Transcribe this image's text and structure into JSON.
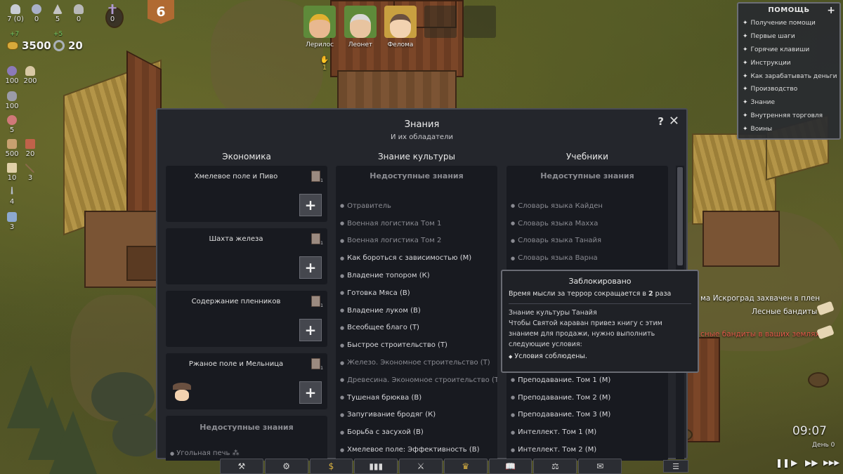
{
  "resources": {
    "top": [
      {
        "icon": "people-icon",
        "value": "7 (0)"
      },
      {
        "icon": "workers-icon",
        "value": "0"
      },
      {
        "icon": "soldiers-icon",
        "value": "5"
      },
      {
        "icon": "prisoners-icon",
        "value": "0"
      },
      {
        "icon": "dead-icon",
        "value": "0"
      }
    ],
    "gold_delta": "+7",
    "gold": "3500",
    "iron_delta": "+5",
    "iron": "20",
    "side": [
      {
        "a": "100",
        "b": "200"
      },
      {
        "a": "100",
        "b": ""
      },
      {
        "a": "5",
        "b": ""
      },
      {
        "a": "500",
        "b": "20"
      },
      {
        "a": "10",
        "b": "3"
      },
      {
        "a": "4",
        "b": ""
      },
      {
        "a": "3",
        "b": ""
      }
    ]
  },
  "day_badge": "6",
  "characters": [
    {
      "name": "Лерилос",
      "color": "#5e8a3a"
    },
    {
      "name": "Леонет",
      "color": "#5e8a3a"
    },
    {
      "name": "Фелома",
      "color": "#c8a040"
    }
  ],
  "char_extra": "1",
  "help": {
    "title": "ПОМОЩЬ",
    "items": [
      "Получение помощи",
      "Первые шаги",
      "Горячие клавиши",
      "Инструкции",
      "Как зарабатывать деньги",
      "Производство",
      "Знание",
      "Внутренняя торговля",
      "Воины"
    ]
  },
  "modal": {
    "title": "Знания",
    "subtitle": "И их обладатели",
    "help_glyph": "?",
    "close_glyph": "✕",
    "columns": [
      "Экономика",
      "Знание культуры",
      "Учебники"
    ],
    "economy": [
      {
        "title": "Хмелевое поле и Пиво",
        "has_face": false
      },
      {
        "title": "Шахта железа",
        "has_face": false
      },
      {
        "title": "Содержание пленников",
        "has_face": false
      },
      {
        "title": "Ржаное поле и Мельница",
        "has_face": true
      }
    ],
    "economy_unavailable": "Недоступные знания",
    "economy_partial_item": "Угольная печь",
    "plus_glyph": "+",
    "culture_head": "Недоступные знания",
    "culture": [
      {
        "text": "Отравитель",
        "dim": true
      },
      {
        "text": "Военная логистика Том 1",
        "dim": true
      },
      {
        "text": "Военная логистика Том 2",
        "dim": true
      },
      {
        "text": "Как бороться с зависимостью (М)",
        "dim": false
      },
      {
        "text": "Владение топором (К)",
        "dim": false
      },
      {
        "text": "Готовка Мяса (В)",
        "dim": false
      },
      {
        "text": "Владение луком (В)",
        "dim": false
      },
      {
        "text": "Всеобщее благо (Т)",
        "dim": false
      },
      {
        "text": "Быстрое строительство (Т)",
        "dim": false
      },
      {
        "text": "Железо. Экономное строительство (Т)",
        "dim": true
      },
      {
        "text": "Древесина. Экономное строительство (Т)",
        "dim": true
      },
      {
        "text": "Тушеная брюква (В)",
        "dim": false
      },
      {
        "text": "Запугивание бродяг (К)",
        "dim": false
      },
      {
        "text": "Борьба с засухой (В)",
        "dim": false
      },
      {
        "text": "Хмелевое поле: Эффективность (В)",
        "dim": false
      }
    ],
    "books_head": "Недоступные знания",
    "books": [
      {
        "text": "Словарь языка Кайден",
        "dim": true
      },
      {
        "text": "Словарь языка Махха",
        "dim": true
      },
      {
        "text": "Словарь языка Танайя",
        "dim": true
      },
      {
        "text": "Словарь языка Варна",
        "dim": true
      },
      {
        "text": "",
        "dim": true
      },
      {
        "text": "",
        "dim": true
      },
      {
        "text": "",
        "dim": true
      },
      {
        "text": "",
        "dim": true
      },
      {
        "text": "",
        "dim": true
      },
      {
        "text": "",
        "dim": true
      },
      {
        "text": "Преподавание. Том 1 (М)",
        "dim": false
      },
      {
        "text": "Преподавание. Том 2 (М)",
        "dim": false
      },
      {
        "text": "Преподавание. Том 3 (М)",
        "dim": false
      },
      {
        "text": "Интеллект. Том 1 (М)",
        "dim": false
      },
      {
        "text": "Интеллект. Том 2 (М)",
        "dim": false
      }
    ]
  },
  "tooltip": {
    "title": "Заблокировано",
    "line1_prefix": "Время мысли за террор сокращается в ",
    "line1_num": "2",
    "line1_suffix": " раза",
    "knowledge": "Знание культуры Танайя",
    "text": "Чтобы Святой караван привез книгу с этим знанием для продажи, нужно выполнить следующие условия:",
    "condition": "Условия соблюдены."
  },
  "notices": [
    {
      "text": "ма Искроград захвачен в плен",
      "color": "#f0f0f0"
    },
    {
      "text": "Лесные бандиты",
      "color": "#f0f0f0"
    },
    {
      "text": "сные бандиты в ваших землях",
      "color": "#e25a4a"
    }
  ],
  "bottom_bar": [
    "⚒",
    "⚙",
    "$",
    "▮▮▮",
    "⚔",
    "♛",
    "📖",
    "⚖",
    "✉"
  ],
  "list_btn": "☰",
  "clock": "09:07",
  "day_text": "День 0",
  "speed": [
    "❚❚",
    "▶",
    "▶▶",
    "▶▶▶"
  ]
}
